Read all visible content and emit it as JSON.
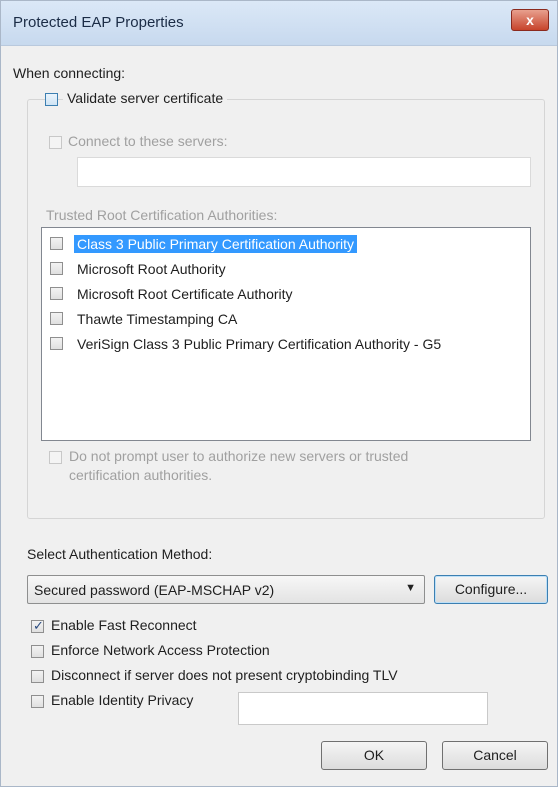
{
  "window": {
    "title": "Protected EAP Properties",
    "close_label": "x"
  },
  "when_connecting": {
    "heading": "When connecting:",
    "validate_server_cert": {
      "label": "Validate server certificate",
      "checked": false
    },
    "connect_to_servers": {
      "label": "Connect to these servers:",
      "checked": false,
      "value": ""
    },
    "trusted_root_heading": "Trusted Root Certification Authorities:",
    "authorities": [
      {
        "label": "Class 3 Public Primary Certification Authority",
        "checked": false,
        "selected": true
      },
      {
        "label": "Microsoft Root Authority",
        "checked": false,
        "selected": false
      },
      {
        "label": "Microsoft Root Certificate Authority",
        "checked": false,
        "selected": false
      },
      {
        "label": "Thawte Timestamping CA",
        "checked": false,
        "selected": false
      },
      {
        "label": "VeriSign Class 3 Public Primary Certification Authority - G5",
        "checked": false,
        "selected": false
      }
    ],
    "do_not_prompt": {
      "line1": "Do not prompt user to authorize new servers or trusted",
      "line2": "certification authorities.",
      "checked": false
    }
  },
  "auth": {
    "heading": "Select Authentication Method:",
    "method_selected": "Secured password (EAP-MSCHAP v2)",
    "configure_label": "Configure..."
  },
  "options": {
    "fast_reconnect": {
      "label": "Enable Fast Reconnect",
      "checked": true
    },
    "nap": {
      "label": "Enforce Network Access Protection",
      "checked": false
    },
    "cryptobinding": {
      "label": "Disconnect if server does not present cryptobinding TLV",
      "checked": false
    },
    "identity_privacy": {
      "label": "Enable Identity Privacy",
      "checked": false,
      "value": ""
    }
  },
  "buttons": {
    "ok": "OK",
    "cancel": "Cancel"
  },
  "colors": {
    "selection": "#3399ff",
    "title_text": "#1b2c46",
    "close_red": "#c7442c"
  }
}
